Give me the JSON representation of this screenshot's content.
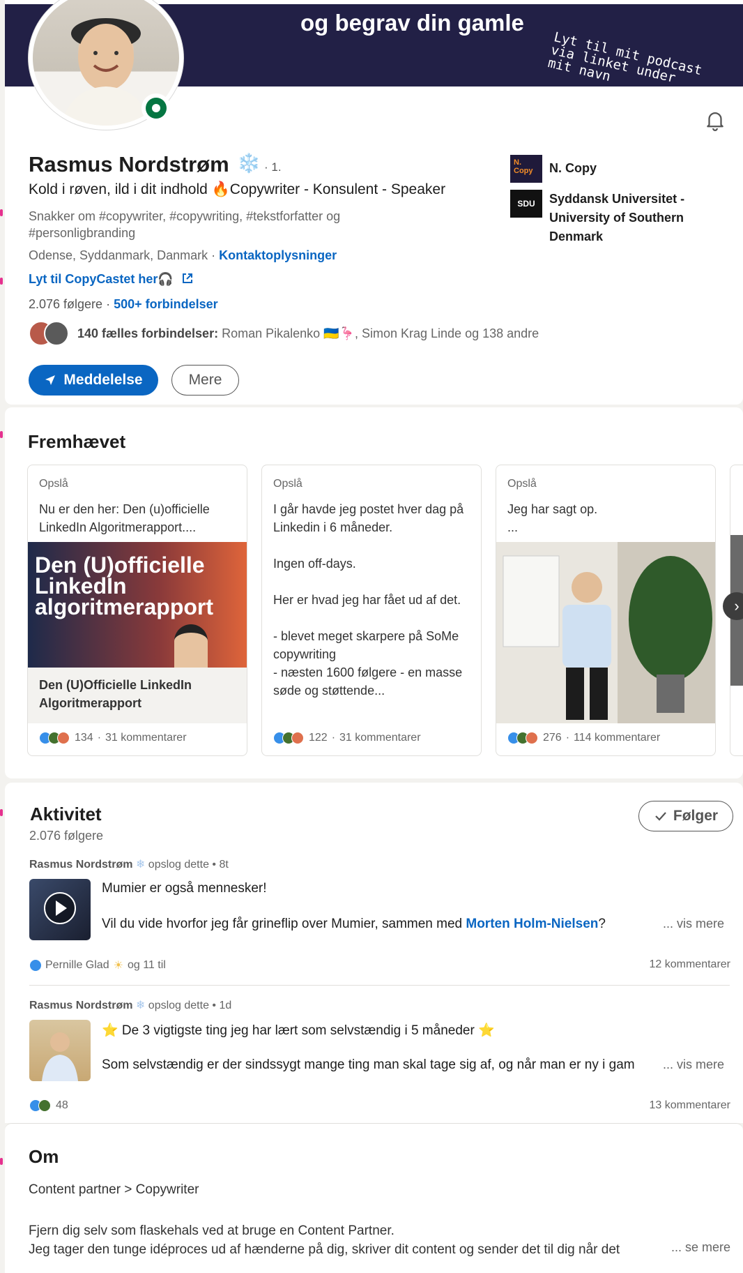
{
  "banner": {
    "top_text": "og begrav din gamle",
    "headline": "og begrav din gamle",
    "note": "Lyt til mit podcast\nvia linket under\nmit navn"
  },
  "profile": {
    "name": "Rasmus Nordstrøm",
    "name_badge": "❄️",
    "degree": "· 1.",
    "headline": "Kold i røven, ild i dit indhold 🔥Copywriter - Konsulent - Speaker",
    "about_tags": "Snakker om #copywriter, #copywriting, #tekstforfatter og #personligbranding",
    "location": "Odense, Syddanmark, Danmark · ",
    "contact_link": "Kontaktoplysninger",
    "podcast_link": "Lyt til CopyCastet her🎧",
    "followers": "2.076 følgere",
    "connections": "500+ forbindelser",
    "mutual_label": "140 fælles forbindelser:",
    "mutual_names": " Roman Pikalenko 🇺🇦🦩, Simon Krag Linde og 138 andre",
    "message_button": "Meddelelse",
    "more_button": "Mere",
    "orgs": [
      {
        "name": "N. Copy",
        "logo": "N.\nCopy"
      },
      {
        "name": "Syddansk Universitet - University of Southern Denmark",
        "logo": "SDU"
      }
    ]
  },
  "featured": {
    "title": "Fremhævet",
    "items": [
      {
        "type": "Opslå",
        "text": "Nu er den her: Den (u)officielle LinkedIn Algoritmerapport....",
        "image_text": "Den (U)officielle LinkedIn algoritmerapport",
        "caption": "Den (U)Officielle LinkedIn Algoritmerapport",
        "reactions": "134",
        "comments": "31 kommentarer"
      },
      {
        "type": "Opslå",
        "text": "I går havde jeg postet hver dag på Linkedin i 6 måneder.\n\nIngen off-days.\n\nHer er hvad jeg har fået ud af det.\n\n- blevet meget skarpere på SoMe copywriting\n- næsten 1600 følgere - en masse søde og støttende...",
        "reactions": "122",
        "comments": "31 kommentarer"
      },
      {
        "type": "Opslå",
        "text": "Jeg har sagt op.\n...",
        "reactions": "276",
        "comments": "114 kommentarer"
      }
    ]
  },
  "activity": {
    "title": "Aktivitet",
    "followers": "2.076 følgere",
    "follow_button": "Følger",
    "posts": [
      {
        "author": "Rasmus Nordstrøm",
        "meta": " opslog dette • 8t",
        "title": "Mumier er også mennesker!",
        "body_pre": "Vil du vide hvorfor jeg får grineflip over Mumier, sammen med ",
        "body_link": "Morten Holm-Nielsen",
        "body_post": "?",
        "see_more": "... vis mere",
        "reactors": "Pernille Glad",
        "reactors_suffix": "og 11 til",
        "comments": "12 kommentarer"
      },
      {
        "author": "Rasmus Nordstrøm",
        "meta": " opslog dette • 1d",
        "title": "⭐ De 3 vigtigste ting jeg har lært som selvstændig i 5 måneder ⭐",
        "body_pre": "Som selvstændig er der sindssygt mange ting man skal tage sig af, og når man er ny i gam",
        "see_more": "... vis mere",
        "reactions": "48",
        "comments": "13 kommentarer"
      }
    ]
  },
  "about": {
    "title": "Om",
    "subtitle": "Content partner > Copywriter",
    "body": "Fjern dig selv som flaskehals ved at bruge en Content Partner.\nJeg tager den tunge idéproces ud af hænderne på dig, skriver dit content og sender det til dig når det",
    "see_more": "... se mere"
  },
  "colors": {
    "accent": "#0a66c2",
    "banner": "#222046",
    "online": "#057642"
  }
}
